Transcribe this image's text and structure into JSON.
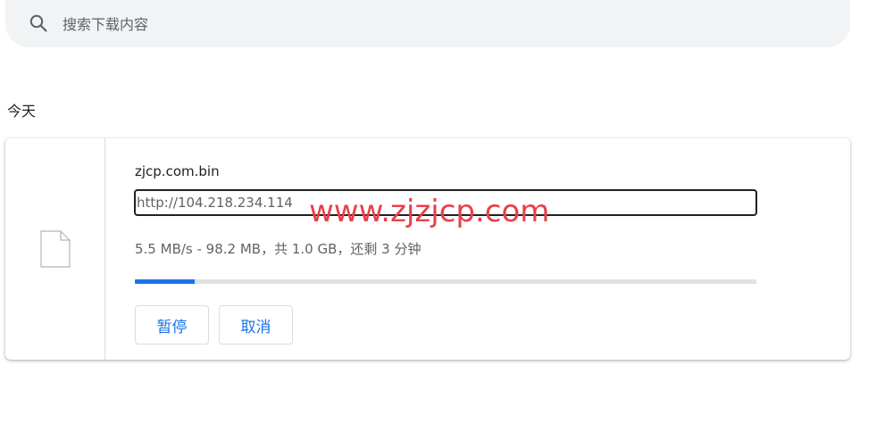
{
  "search": {
    "placeholder": "搜索下载内容",
    "icon": "search-icon"
  },
  "date_group": {
    "label": "今天"
  },
  "download": {
    "file_name": "zjcp.com.bin",
    "source_url": "http://104.218.234.114",
    "watermark": "www.zjzjcp.com",
    "status": "5.5 MB/s - 98.2 MB，共 1.0 GB，还剩 3 分钟",
    "progress_fraction": 0.0959,
    "icon": "file-icon",
    "pause_label": "暂停",
    "cancel_label": "取消"
  },
  "colors": {
    "accent": "#1a73e8",
    "watermark": "#e8404a",
    "search_bg": "#f1f3f4",
    "progress_track": "#dfe1e5"
  }
}
